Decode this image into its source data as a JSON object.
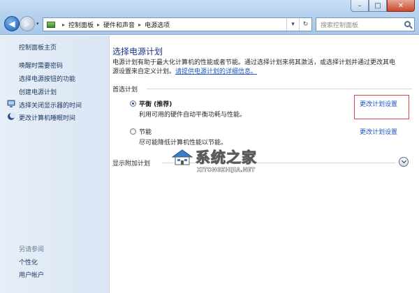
{
  "window": {
    "minimize_glyph": "–",
    "maximize_glyph": "□",
    "close_glyph": "✕"
  },
  "address_bar": {
    "crumbs": [
      "控制面板",
      "硬件和声音",
      "电源选项"
    ],
    "separator": "▸",
    "refresh_glyph": "↻",
    "dropdown_glyph": "▾"
  },
  "search": {
    "placeholder": "搜索控制面板"
  },
  "sidebar": {
    "home_link": "控制面板主页",
    "tasks": [
      {
        "label": "唤醒时需要密码",
        "icon": ""
      },
      {
        "label": "选择电源按钮的功能",
        "icon": ""
      },
      {
        "label": "创建电源计划",
        "icon": ""
      },
      {
        "label": "选择关闭显示器的时间",
        "icon": "monitor-icon"
      },
      {
        "label": "更改计算机睡眠时间",
        "icon": "moon-icon"
      }
    ],
    "see_also_title": "另请参阅",
    "see_also": [
      "个性化",
      "用户帐户"
    ]
  },
  "main": {
    "title": "选择电源计划",
    "description_line1": "电源计划有助于最大化计算机的性能或者节能。通过选择计划来将其激活，或选择计划并通过更改其电",
    "description_line2_prefix": "源设置来自定义计划。",
    "description_link": "请提供电源计划的详细信息。",
    "preferred_header": "首选计划",
    "plans": [
      {
        "name": "平衡 (推荐)",
        "desc": "利用可用的硬件自动平衡功耗与性能。",
        "link": "更改计划设置",
        "selected": true
      },
      {
        "name": "节能",
        "desc": "尽可能降低计算机性能以节能。",
        "link": "更改计划设置",
        "selected": false
      }
    ],
    "additional_header": "显示附加计划"
  },
  "watermark": {
    "text": "系统之家",
    "url": "XITONGZHIJIA.NET"
  },
  "colors": {
    "link": "#1c55c4",
    "title": "#1e3287",
    "highlight": "#e0404a"
  }
}
